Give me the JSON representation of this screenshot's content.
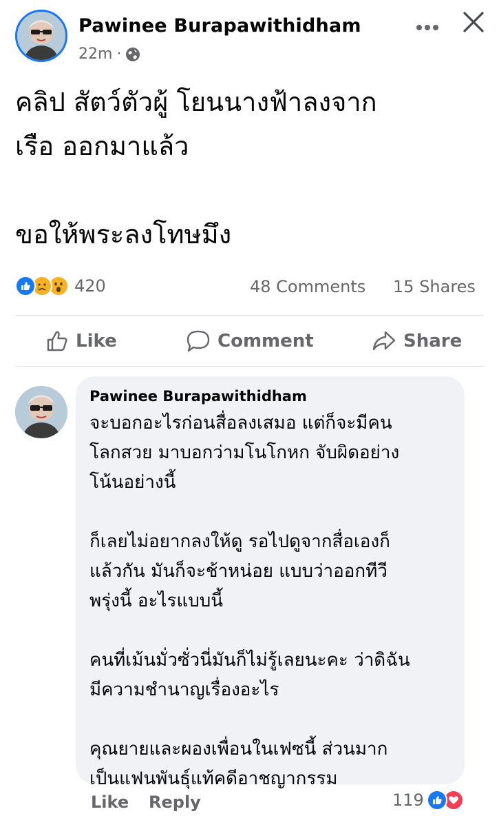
{
  "post": {
    "author": "Pawinee Burapawithidham",
    "time": "22m",
    "separator": "·",
    "privacy_icon": "globe-icon",
    "text_lines_1": [
      "คลิป สัตว์ตัวผู้ โยนนางฟ้าลงจาก",
      "เรือ ออกมาแล้ว"
    ],
    "text_lines_2": [
      "ขอให้พระลงโทษมึง"
    ],
    "reactions": {
      "icons": [
        "like-icon",
        "sad-icon",
        "wow-icon"
      ],
      "count": "420"
    },
    "comments_count": "48 Comments",
    "shares_count": "15 Shares"
  },
  "actions": {
    "like": "Like",
    "comment": "Comment",
    "share": "Share"
  },
  "comment": {
    "author": "Pawinee Burapawithidham",
    "paragraphs": [
      [
        "จะบอกอะไรก่อนสื่อลงเสมอ แต่ก็จะมีคน",
        "โลกสวย มาบอกว่ามโนโกหก จับผิดอย่าง",
        "โน้นอย่างนี้"
      ],
      [
        "ก็เลยไม่อยากลงให้ดู รอไปดูจากสื่อเองก็",
        "แล้วกัน มันก็จะช้าหน่อย แบบว่าออกทีวี",
        "พรุ่งนี้ อะไรแบบนี้"
      ],
      [
        "คนที่เม้นมั่วซั่วนี่มันก็ไม่รู้เลยนะคะ ว่าดิฉัน",
        "มีความชำนาญเรื่องอะไร"
      ],
      [
        "คุณยายและผองเพื่อนในเฟซนี้ ส่วนมาก",
        "เป็นแฟนพันธุ์แท้คดีอาชญากรรม"
      ]
    ],
    "like_label": "Like",
    "reply_label": "Reply",
    "reaction_count": "119",
    "reaction_icons": [
      "like-icon",
      "love-icon"
    ]
  },
  "colors": {
    "accent": "#1877f2",
    "secondary_text": "#65676b",
    "bubble": "#f0f2f5",
    "love": "#f33e58",
    "wow": "#f7b125"
  }
}
